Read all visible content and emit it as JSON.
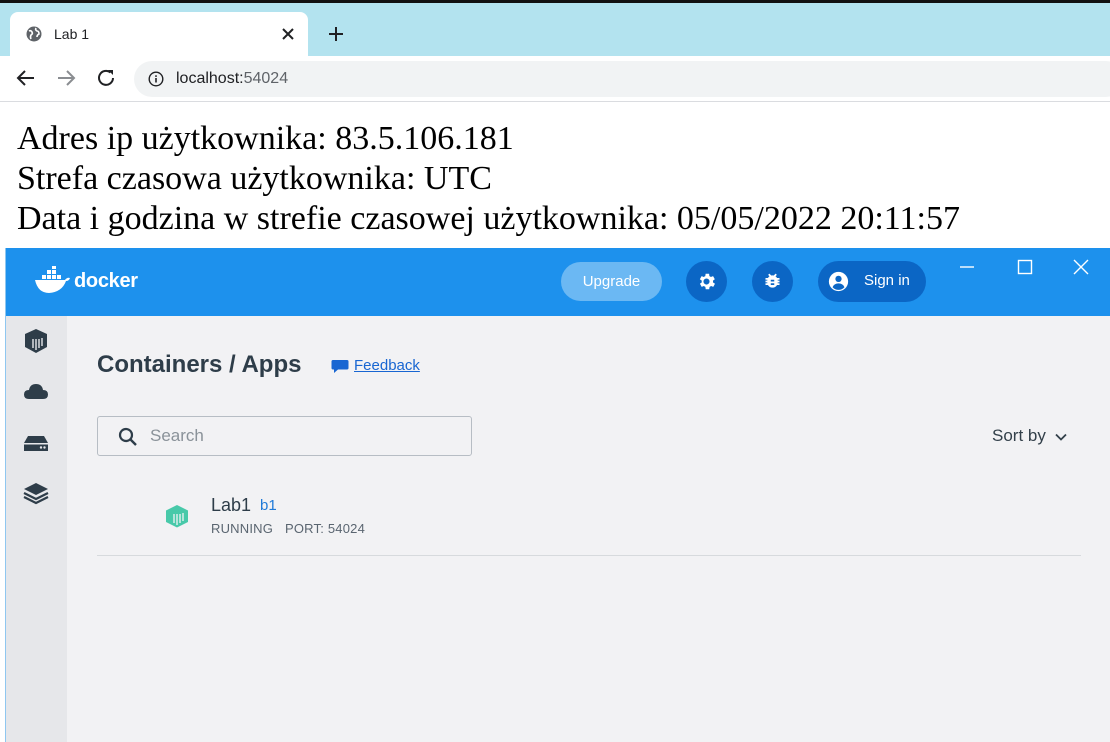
{
  "browser": {
    "tab_title": "Lab 1",
    "url_host": "localhost:",
    "url_port": "54024",
    "icons": {
      "tab": "globe-icon",
      "close": "close-icon",
      "new_tab": "plus-icon",
      "back": "arrow-left-icon",
      "forward": "arrow-right-icon",
      "reload": "reload-icon",
      "site_info": "info-icon"
    }
  },
  "page": {
    "lines": [
      "Adres ip użytkownika: 83.5.106.181",
      "Strefa czasowa użytkownika: UTC",
      "Data i godzina w strefie czasowej użytkownika: 05/05/2022 20:11:57"
    ]
  },
  "docker": {
    "logo_text": "docker",
    "upgrade_label": "Upgrade",
    "signin_label": "Sign in",
    "title": "Containers / Apps",
    "feedback_label": "Feedback",
    "search_placeholder": "Search",
    "search_value": "",
    "sort_label": "Sort by",
    "sidebar": [
      {
        "icon": "containers-icon"
      },
      {
        "icon": "cloud-icon"
      },
      {
        "icon": "volumes-icon"
      },
      {
        "icon": "dev-environments-icon"
      }
    ],
    "containers": [
      {
        "name": "Lab1",
        "tag": "b1",
        "status": "RUNNING",
        "port": "PORT: 54024"
      }
    ],
    "colors": {
      "header": "#1d91ed",
      "header_button": "#0b66c5",
      "running": "#48c9a9",
      "link": "#1866d2"
    }
  }
}
